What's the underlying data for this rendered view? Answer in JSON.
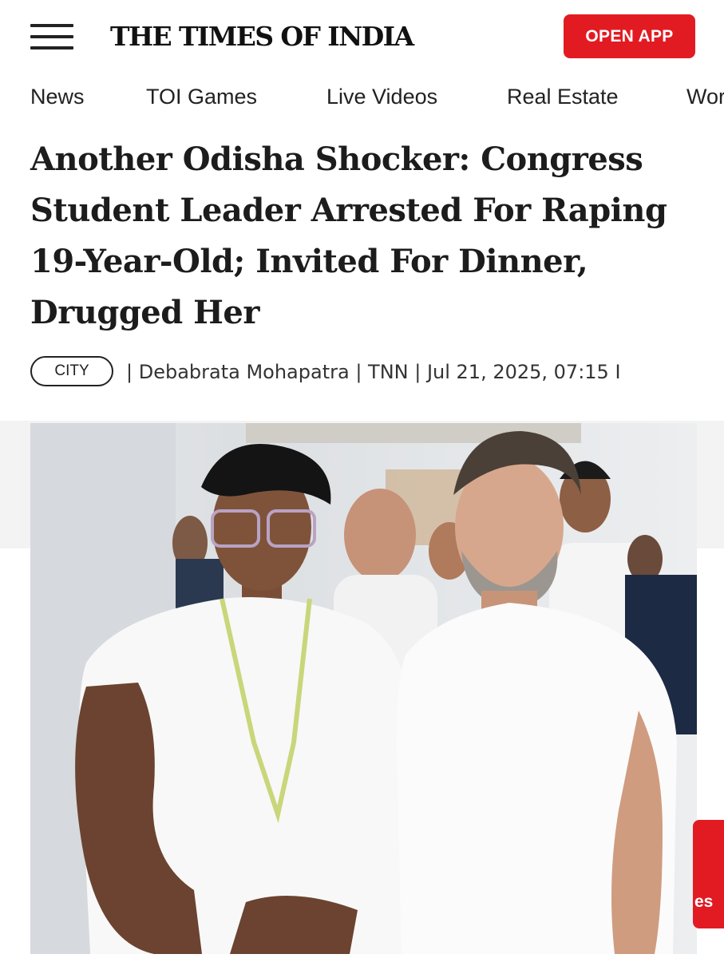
{
  "header": {
    "logo": "THE TIMES OF INDIA",
    "open_app": "OPEN APP"
  },
  "nav": {
    "items": [
      "News",
      "TOI Games",
      "Live Videos",
      "Real Estate",
      "Wor"
    ]
  },
  "article": {
    "headline": "Another Odisha Shocker: Congress Student Leader Arrested For Raping 19-Year-Old; Invited For Dinner, Drugged Her",
    "category": "CITY",
    "byline": "| Debabrata Mohapatra | TNN | Jul 21, 2025, 07:15 I"
  },
  "side_tab": {
    "text": "es"
  },
  "colors": {
    "accent": "#e21b23",
    "text": "#1c1c1c"
  }
}
